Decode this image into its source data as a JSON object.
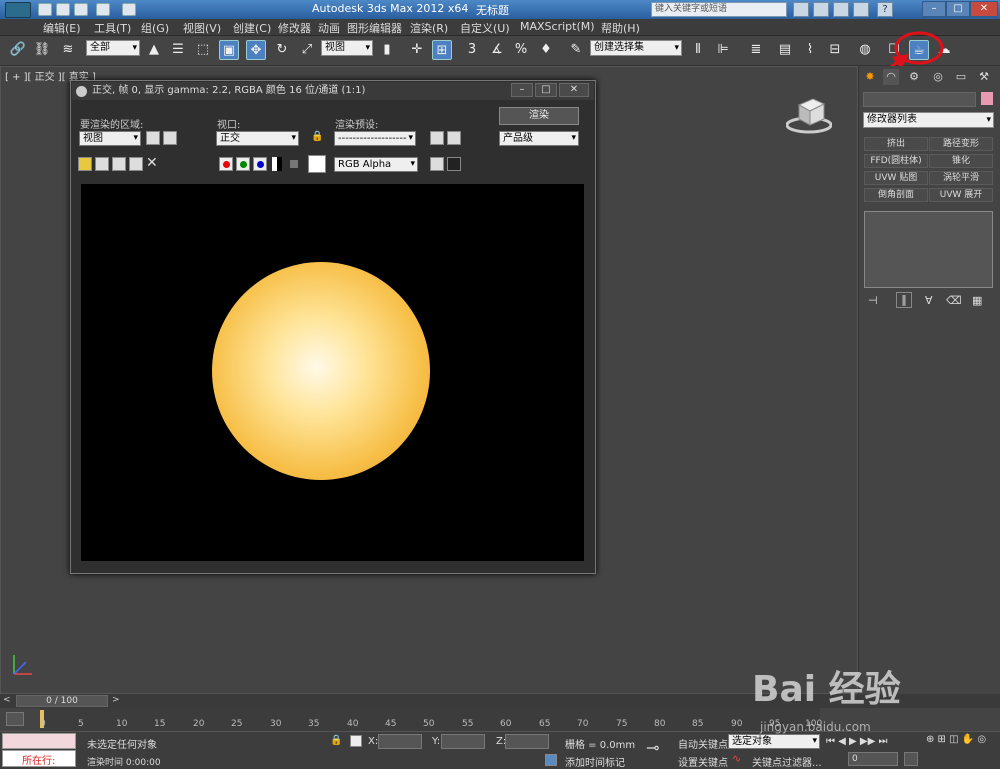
{
  "title": {
    "app": "Autodesk 3ds Max  2012 x64",
    "file": "无标题",
    "search_placeholder": "键入关键字或短语"
  },
  "menu": [
    "编辑(E)",
    "工具(T)",
    "组(G)",
    "视图(V)",
    "创建(C)",
    "修改器",
    "动画",
    "图形编辑器",
    "渲染(R)",
    "自定义(U)",
    "MAXScript(M)",
    "帮助(H)"
  ],
  "toolbar": {
    "selection_filter": "全部",
    "ref_coord": "视图",
    "named_selection": "创建选择集"
  },
  "viewport": {
    "label": "[ + ][ 正交 ][ 真实 ]"
  },
  "render_frame": {
    "title": "正交, 帧 0, 显示 gamma: 2.2, RGBA 颜色 16 位/通道 (1:1)",
    "area_label": "要渲染的区域:",
    "area_value": "视图",
    "viewport_label": "视口:",
    "viewport_value": "正交",
    "preset_label": "渲染预设:",
    "preset_value": "-------------------",
    "render_button": "渲染",
    "quality_value": "产品级",
    "channel_value": "RGB Alpha"
  },
  "command_panel": {
    "modifier_list": "修改器列表",
    "modifier_buttons": [
      "挤出",
      "路径变形",
      "FFD(圆柱体)",
      "锥化",
      "UVW 贴图",
      "涡轮平滑",
      "倒角剖面",
      "UVW 展开"
    ]
  },
  "timeline": {
    "frame_display": "0 / 100",
    "ticks": [
      "0",
      "5",
      "10",
      "15",
      "20",
      "25",
      "30",
      "35",
      "40",
      "45",
      "50",
      "55",
      "60",
      "65",
      "70",
      "75",
      "80",
      "85",
      "90",
      "95",
      "100"
    ]
  },
  "status": {
    "script_label": "所在行:",
    "selection_status": "未选定任何对象",
    "render_time": "渲染时间  0:00:00",
    "x_label": "X:",
    "y_label": "Y:",
    "z_label": "Z:",
    "grid": "栅格 = 0.0mm",
    "add_time_tag": "添加时间标记",
    "auto_key": "自动关键点",
    "set_key": "设置关键点",
    "selected_object": "选定对象",
    "key_filters": "关键点过滤器...",
    "frame_value": "0"
  },
  "watermark": {
    "brand": "Bai 经验",
    "url": "jingyan.baidu.com"
  },
  "colors": {
    "accent_blue": "#4d80c0",
    "annotation_red": "#e0101a",
    "sphere": "#f7c04a"
  }
}
